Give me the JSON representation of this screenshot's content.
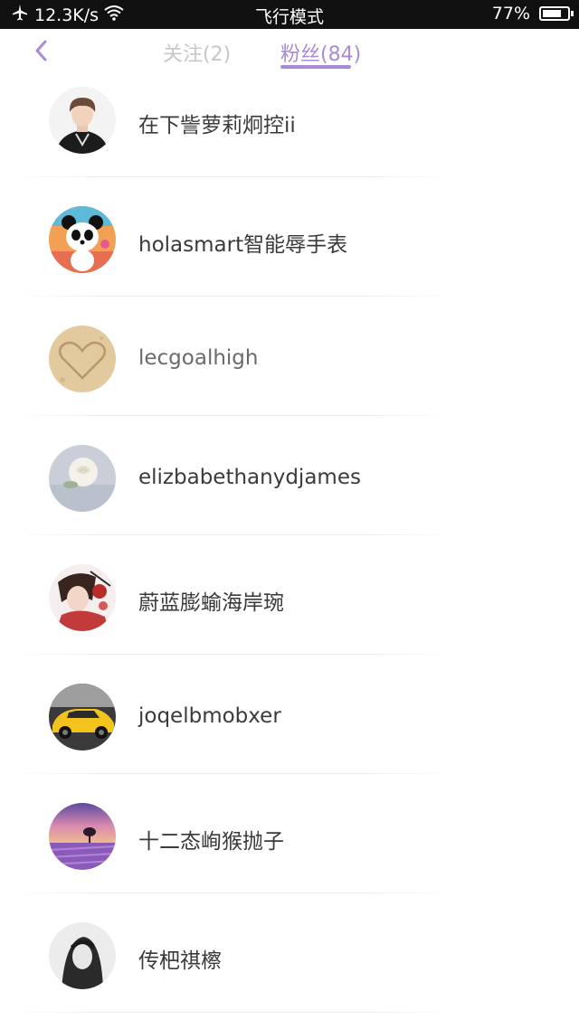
{
  "status_bar": {
    "speed": "12.3K/s",
    "mode": "飞行模式",
    "battery_text": "77%",
    "battery_level": 0.77,
    "airplane_icon": "airplane-icon",
    "wifi_icon": "wifi-icon",
    "battery_icon": "battery-icon"
  },
  "header": {
    "back_icon": "chevron-left-icon",
    "tabs": [
      {
        "label": "关注(2)",
        "active": false
      },
      {
        "label": "粉丝(84)",
        "active": true
      }
    ],
    "accent_color": "#a98ad8"
  },
  "followers": [
    {
      "name": "在下訾萝莉炯控ii",
      "avatar": "avatar-man-black-jacket"
    },
    {
      "name": "holasmart智能辱手表",
      "avatar": "avatar-panda"
    },
    {
      "name": "lecgoalhigh",
      "avatar": "avatar-sand-heart"
    },
    {
      "name": "elizbabethanydjames",
      "avatar": "avatar-white-rose"
    },
    {
      "name": "蔚蓝膨蝓海岸琬",
      "avatar": "avatar-anime-boy"
    },
    {
      "name": "joqelbmobxer",
      "avatar": "avatar-yellow-car"
    },
    {
      "name": "十二态峋猴抛子",
      "avatar": "avatar-lavender-tree"
    },
    {
      "name": "传杷祺檫",
      "avatar": "avatar-girl-bw"
    }
  ]
}
